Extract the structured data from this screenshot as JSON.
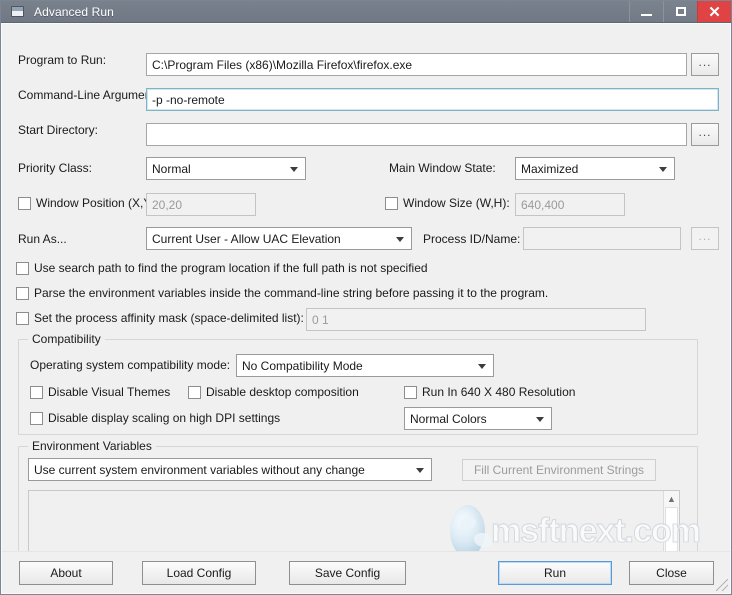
{
  "window": {
    "title": "Advanced Run",
    "icon": "app-window-icon",
    "controls": {
      "minimize": "minimize-button",
      "maximize": "maximize-button",
      "close_glyph": "✕"
    },
    "close_color": "#e04343",
    "titlebar_color": "#79818c"
  },
  "fields": {
    "program_to_run": {
      "label": "Program to Run:",
      "value": "C:\\Program Files (x86)\\Mozilla Firefox\\firefox.exe",
      "browse_label": "..."
    },
    "command_line_arguments": {
      "label": "Command-Line Arguments:",
      "value": "-p -no-remote",
      "focused": true
    },
    "start_directory": {
      "label": "Start Directory:",
      "value": "",
      "browse_label": "..."
    },
    "priority_class": {
      "label": "Priority Class:",
      "value": "Normal"
    },
    "main_window_state": {
      "label": "Main Window State:",
      "value": "Maximized"
    },
    "window_position": {
      "label": "Window Position (X,Y):",
      "checked": false,
      "value": "20,20",
      "disabled": true
    },
    "window_size": {
      "label": "Window Size (W,H):",
      "checked": false,
      "value": "640,400",
      "disabled": true
    },
    "run_as": {
      "label": "Run As...",
      "value": "Current User - Allow UAC Elevation"
    },
    "process_id_name": {
      "label": "Process ID/Name:",
      "value": "",
      "disabled": true,
      "browse_label": "..."
    }
  },
  "options": {
    "use_search_path": {
      "label": "Use search path to find the program location if the full path is not specified",
      "checked": false
    },
    "parse_env_vars": {
      "label": "Parse the environment variables inside the command-line string before passing it to the program.",
      "checked": false
    },
    "affinity_mask": {
      "label": "Set the process affinity mask (space-delimited list):",
      "checked": false,
      "value": "0 1",
      "disabled": true
    }
  },
  "compatibility": {
    "group_title": "Compatibility",
    "os_mode_label": "Operating system compatibility mode:",
    "os_mode_value": "No Compatibility Mode",
    "checkboxes": [
      {
        "label": "Disable Visual Themes",
        "checked": false
      },
      {
        "label": "Disable desktop composition",
        "checked": false
      },
      {
        "label": "Run In 640 X 480 Resolution",
        "checked": false
      },
      {
        "label": "Disable display scaling on high DPI settings",
        "checked": false
      }
    ],
    "colors_value": "Normal Colors"
  },
  "environment": {
    "group_title": "Environment Variables",
    "mode_value": "Use current system environment variables without any change",
    "fill_button_label": "Fill Current Environment Strings",
    "fill_button_disabled": true,
    "textarea_value": ""
  },
  "watermark": {
    "text": "msftnext.com",
    "icon": "globe-icon"
  },
  "footer": {
    "about": "About",
    "load_config": "Load Config",
    "save_config": "Save Config",
    "run": "Run",
    "close": "Close"
  }
}
